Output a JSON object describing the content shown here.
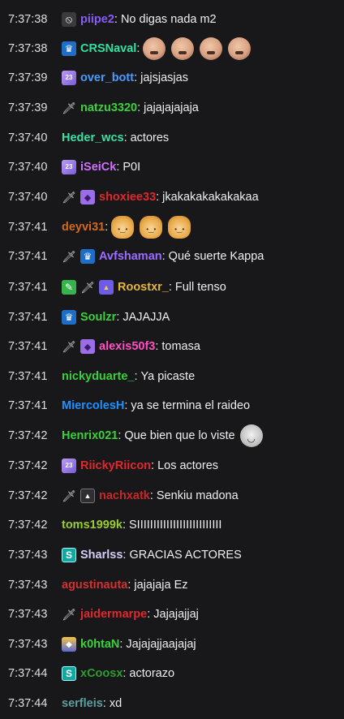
{
  "chat": {
    "messages": [
      {
        "time": "7:37:38",
        "badges": [
          "hide-icon"
        ],
        "user": "piipe2",
        "color": "#8a5cf6",
        "text": "No digas nada m2",
        "emotes": []
      },
      {
        "time": "7:37:38",
        "badges": [
          "crown-icon"
        ],
        "user": "CRSNaval",
        "color": "#2fe0a1",
        "text": "",
        "emotes": [
          "bald-face-emote",
          "bald-face-emote",
          "bald-face-emote",
          "bald-face-emote"
        ]
      },
      {
        "time": "7:37:39",
        "badges": [
          "calendar-icon"
        ],
        "user": "over_bott",
        "color": "#4a9bff",
        "text": "jajsjasjas",
        "emotes": []
      },
      {
        "time": "7:37:39",
        "badges": [
          "sword-icon"
        ],
        "user": "natzu3320",
        "color": "#3ad13a",
        "text": "jajajajajaja",
        "emotes": []
      },
      {
        "time": "7:37:40",
        "badges": [],
        "user": "Heder_wcs",
        "color": "#3ce0a3",
        "text": "actores",
        "emotes": []
      },
      {
        "time": "7:37:40",
        "badges": [
          "calendar-icon"
        ],
        "user": "iSeiCk",
        "color": "#d070ff",
        "text": "P0I",
        "emotes": []
      },
      {
        "time": "7:37:40",
        "badges": [
          "sword-icon",
          "drop-icon"
        ],
        "user": "shoxiee33",
        "color": "#e0282c",
        "text": "jkakakakakakakaa",
        "emotes": []
      },
      {
        "time": "7:37:41",
        "badges": [],
        "user": "deyvi31",
        "color": "#d2691e",
        "text": "",
        "emotes": [
          "doge-emote",
          "doge-emote",
          "doge-emote"
        ]
      },
      {
        "time": "7:37:41",
        "badges": [
          "sword-icon",
          "crown-icon"
        ],
        "user": "Avfshaman",
        "color": "#9b6dff",
        "text": "Qué suerte Kappa",
        "emotes": []
      },
      {
        "time": "7:37:41",
        "badges": [
          "green-pencil-icon",
          "sword-icon",
          "cake-icon"
        ],
        "user": "Roostxr_",
        "color": "#e6b53d",
        "text": "Full tenso",
        "emotes": []
      },
      {
        "time": "7:37:41",
        "badges": [
          "crown-icon"
        ],
        "user": "Soulzr",
        "color": "#3ad13a",
        "text": "JAJAJJA",
        "emotes": []
      },
      {
        "time": "7:37:41",
        "badges": [
          "sword-icon",
          "drop-icon"
        ],
        "user": "alexis50f3",
        "color": "#ff4fc0",
        "text": "tomasa",
        "emotes": []
      },
      {
        "time": "7:37:41",
        "badges": [],
        "user": "nickyduarte_",
        "color": "#3ad13a",
        "text": "Ya picaste",
        "emotes": []
      },
      {
        "time": "7:37:41",
        "badges": [],
        "user": "MiercolesH",
        "color": "#1e90ff",
        "text": "ya se termina el raideo",
        "emotes": []
      },
      {
        "time": "7:37:42",
        "badges": [],
        "user": "Henrix021",
        "color": "#3ad13a",
        "text": "Que bien que lo viste",
        "emotes": [
          "smiling-face-emote"
        ]
      },
      {
        "time": "7:37:42",
        "badges": [
          "calendar-icon"
        ],
        "user": "RiickyRiicon",
        "color": "#e0282c",
        "text": "Los actores",
        "emotes": []
      },
      {
        "time": "7:37:42",
        "badges": [
          "sword-icon",
          "triangle-icon"
        ],
        "user": "nachxatk",
        "color": "#c62828",
        "text": "Senkiu madona",
        "emotes": []
      },
      {
        "time": "7:37:42",
        "badges": [],
        "user": "toms1999k",
        "color": "#9acd32",
        "text": "SIIIIIIIIIIIIIIIIIIIIIIIIII",
        "emotes": []
      },
      {
        "time": "7:37:43",
        "badges": [
          "s-badge-icon"
        ],
        "user": "Sharlss",
        "color": "#d7cdf7",
        "text": "GRACIAS ACTORES",
        "emotes": []
      },
      {
        "time": "7:37:43",
        "badges": [],
        "user": "agustinauta",
        "color": "#d23131",
        "text": "jajajaja Ez",
        "emotes": []
      },
      {
        "time": "7:37:43",
        "badges": [
          "sword-icon"
        ],
        "user": "jaidermarpe",
        "color": "#e0282c",
        "text": "Jajajajjaj",
        "emotes": []
      },
      {
        "time": "7:37:43",
        "badges": [
          "medal-2022-icon"
        ],
        "user": "k0htaN",
        "color": "#3ad13a",
        "text": "Jajajajjaajajaj",
        "emotes": []
      },
      {
        "time": "7:37:44",
        "badges": [
          "s-badge-icon"
        ],
        "user": "xCoosx",
        "color": "#2e9d2e",
        "text": "actorazo",
        "emotes": []
      },
      {
        "time": "7:37:44",
        "badges": [],
        "user": "serfleis",
        "color": "#5f9ea0",
        "text": "xd",
        "emotes": []
      }
    ]
  }
}
